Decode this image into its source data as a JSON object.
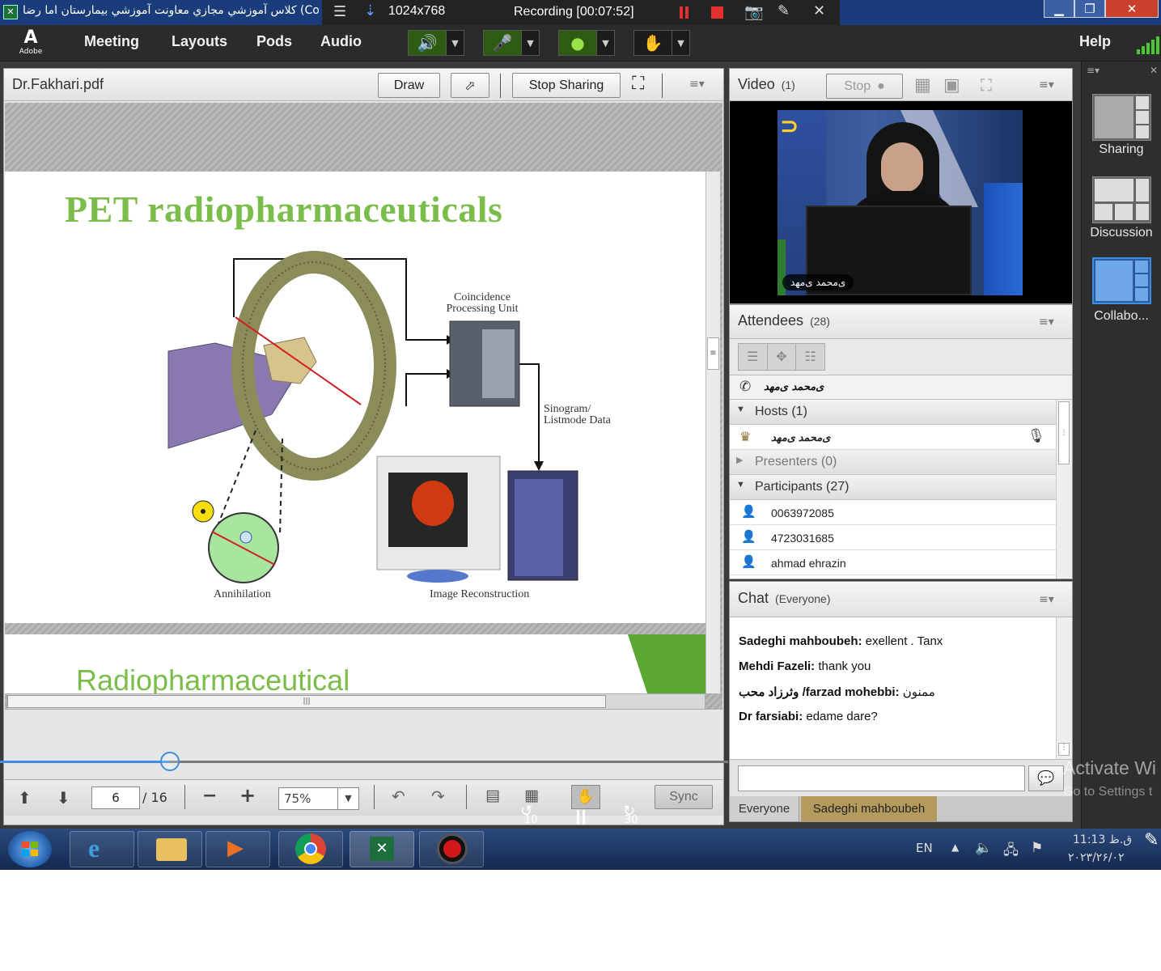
{
  "window": {
    "title": "كلاس آموزشي مجازي معاونت آموزشي بيمارستان اما رضا (Co",
    "resolution": "1024x768",
    "recording": "Recording [00:07:52]"
  },
  "menubar": {
    "logo_text": "Adobe",
    "items": [
      "Meeting",
      "Layouts",
      "Pods",
      "Audio"
    ],
    "help": "Help"
  },
  "share_pod": {
    "title": "Dr.Fakhari.pdf",
    "draw_label": "Draw",
    "stop_sharing_label": "Stop Sharing",
    "slide_title": "PET radiopharmaceuticals",
    "labels": {
      "coincidence": "Coincidence Processing Unit",
      "sinogram": "Sinogram/ Listmode Data",
      "annihilation": "Annihilation",
      "image_recon": "Image Reconstruction"
    },
    "next_slide_title": "Radiopharmaceutical",
    "page_current": "6",
    "page_total": "/ 16",
    "zoom": "75%",
    "sync_label": "Sync"
  },
  "player": {
    "progress": 0.233,
    "rewind_label": "10",
    "forward_label": "30"
  },
  "video_pod": {
    "title": "Video",
    "count": "(1)",
    "stop_label": "Stop",
    "name_tag": "ی‌محمد ی‌مهد"
  },
  "attendees_pod": {
    "title": "Attendees",
    "count": "(28)",
    "current_user": "ی‌محمد ی‌مهد",
    "hosts_label": "Hosts (1)",
    "host_name": "ی‌محمد ی‌مهد",
    "presenters_label": "Presenters (0)",
    "participants_label": "Participants (27)",
    "participants": [
      "0063972085",
      "4723031685",
      "ahmad ehrazin"
    ]
  },
  "chat_pod": {
    "title": "Chat",
    "scope": "(Everyone)",
    "messages": [
      {
        "name": "Sadeghi  mahboubeh:",
        "text": " exellent .  Tanx"
      },
      {
        "name": "Mehdi Fazeli:",
        "text": " thank you"
      },
      {
        "name": "وثرزاد محب /farzad mohebbi:",
        "text": " ممنون"
      },
      {
        "name": "Dr farsiabi:",
        "text": " edame dare?"
      }
    ],
    "tabs": [
      "Everyone",
      "Sadeghi  mahboubeh"
    ]
  },
  "layouts": [
    "Sharing",
    "Discussion",
    "Collabo..."
  ],
  "watermark": {
    "line1": "Activate Wi",
    "line2": "Go to Settings t"
  },
  "taskbar": {
    "lang": "EN",
    "time": "11:13 ق.ظ",
    "date": "۲۰۲۳/۲۶/۰۲"
  },
  "colors": {
    "slide_title_green": "#7bbd4a",
    "accent_blue": "#3d8ee0",
    "record_red": "#e53030"
  }
}
